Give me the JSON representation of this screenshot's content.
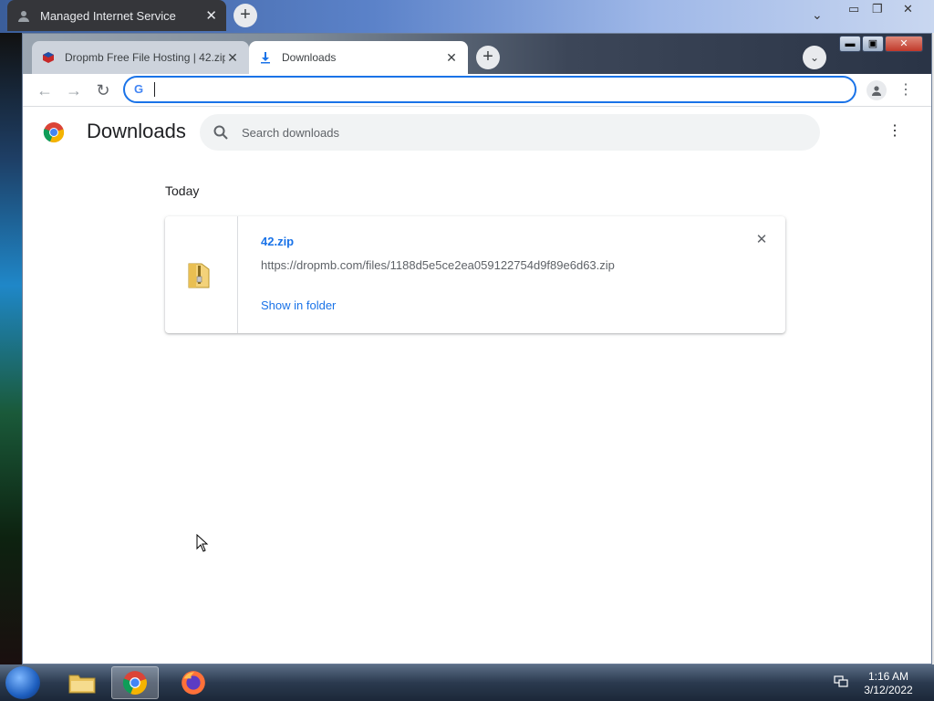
{
  "outer_browser": {
    "tab_title": "Managed Internet Service"
  },
  "browser": {
    "tabs": [
      {
        "title": "Dropmb Free File Hosting | 42.zip",
        "active": false
      },
      {
        "title": "Downloads",
        "active": true
      }
    ],
    "omnibox": {
      "value": "",
      "placeholder": ""
    }
  },
  "downloads_page": {
    "title": "Downloads",
    "search": {
      "placeholder": "Search downloads"
    },
    "section_label": "Today",
    "items": [
      {
        "file_name": "42.zip",
        "url": "https://dropmb.com/files/1188d5e5ce2ea059122754d9f89e6d63.zip",
        "action": "Show in folder"
      }
    ]
  },
  "taskbar": {
    "time": "1:16 AM",
    "date": "3/12/2022"
  },
  "colors": {
    "accent": "#1a73e8",
    "focus_ring": "#1a73e8"
  }
}
